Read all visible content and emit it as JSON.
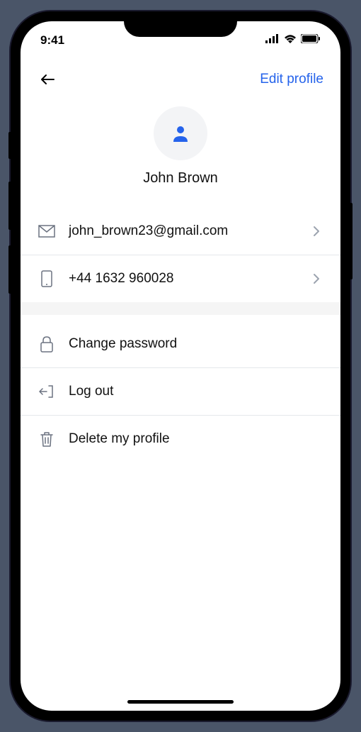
{
  "status": {
    "time": "9:41"
  },
  "header": {
    "edit_label": "Edit profile"
  },
  "profile": {
    "name": "John Brown"
  },
  "contact": {
    "email": "john_brown23@gmail.com",
    "phone": "+44 1632 960028"
  },
  "actions": {
    "change_password": "Change password",
    "log_out": "Log out",
    "delete_profile": "Delete my profile"
  }
}
